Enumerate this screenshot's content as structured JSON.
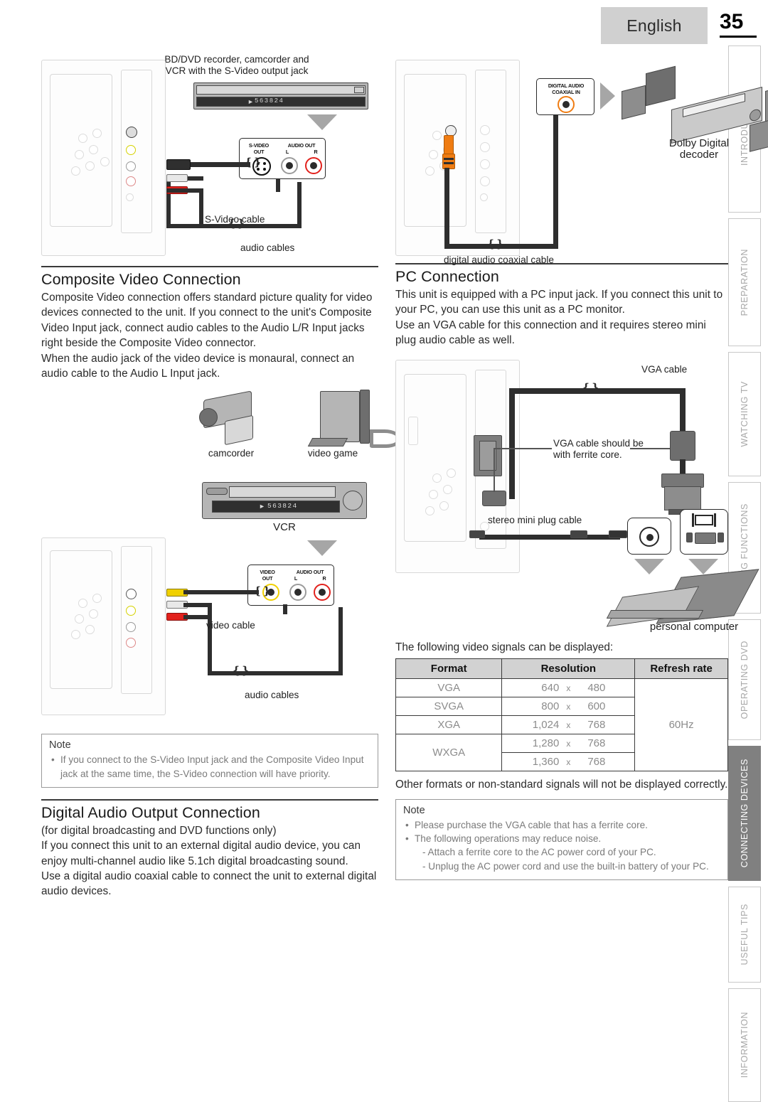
{
  "header": {
    "language": "English",
    "page_number": "35"
  },
  "side_tabs": [
    {
      "label": "INTRODUCTION",
      "active": false
    },
    {
      "label": "PREPARATION",
      "active": false
    },
    {
      "label": "WATCHING TV",
      "active": false
    },
    {
      "label": "USING FUNCTIONS",
      "active": false
    },
    {
      "label": "OPERATING DVD",
      "active": false
    },
    {
      "label": "CONNECTING DEVICES",
      "active": true
    },
    {
      "label": "USEFUL TIPS",
      "active": false
    },
    {
      "label": "INFORMATION",
      "active": false
    }
  ],
  "svideo_diagram": {
    "caption_line1": "BD/DVD recorder, camcorder and",
    "caption_line2": "VCR with the S-Video output jack",
    "vcr_display": "563824",
    "jack_panel": {
      "svideo_label_line1": "S-VIDEO",
      "svideo_label_line2": "OUT",
      "audio_label": "AUDIO OUT",
      "audio_left": "L",
      "audio_right": "R"
    },
    "cable_svideo": "S-Video cable",
    "cable_audio": "audio cables"
  },
  "composite": {
    "title": "Composite Video Connection",
    "paragraph1": "Composite Video connection offers standard picture quality for video devices connected to the unit. If you connect to the unit's Composite Video Input jack, connect audio cables to the Audio L/R Input jacks right beside the Composite Video connector.",
    "paragraph2": "When the audio jack of the video device is monaural, connect an audio cable to the Audio L Input jack.",
    "devices": {
      "camcorder": "camcorder",
      "video_game": "video game",
      "vcr": "VCR",
      "vcr_display": "563824"
    },
    "jack_panel": {
      "video_label_line1": "VIDEO",
      "video_label_line2": "OUT",
      "audio_label": "AUDIO OUT",
      "audio_left": "L",
      "audio_right": "R"
    },
    "cable_video": "video cable",
    "cable_audio": "audio cables",
    "note": {
      "title": "Note",
      "items": [
        "If you connect to the S-Video Input jack and the Composite Video Input jack at the same time, the S-Video connection will have priority."
      ]
    }
  },
  "digital_audio": {
    "title": "Digital Audio Output Connection",
    "subtitle": "(for digital broadcasting and DVD functions only)",
    "paragraph1": "If you connect this unit to an external digital audio device, you can enjoy multi-channel audio like 5.1ch digital broadcasting sound.",
    "paragraph2": "Use a digital audio coaxial cable to connect the unit to external digital audio devices.",
    "jack_label_line1": "DIGITAL AUDIO",
    "jack_label_line2": "COAXIAL  IN",
    "decoder_line1": "Dolby Digital",
    "decoder_line2": "decoder",
    "cable_label": "digital audio coaxial cable"
  },
  "pc": {
    "title": "PC Connection",
    "paragraph1": "This unit is equipped with a PC input jack. If you connect this unit to your PC, you can use this unit as a PC monitor.",
    "paragraph2": "Use an VGA cable for this connection and it requires stereo mini plug audio cable as well.",
    "label_vga_cable": "VGA cable",
    "label_ferrite_line1": "VGA cable should be",
    "label_ferrite_line2": "with ferrite core.",
    "label_stereo_mini": "stereo mini plug cable",
    "label_pc": "personal computer",
    "signals_intro": "The following video signals can be displayed:",
    "other_formats": "Other formats or non-standard signals will not be displayed correctly.",
    "note": {
      "title": "Note",
      "items": [
        "Please purchase the VGA cable that has a ferrite core.",
        "The following operations may reduce noise."
      ],
      "subitems": [
        "- Attach a ferrite core to the AC power cord of your PC.",
        "- Unplug the AC power cord and use the built-in battery of your PC."
      ]
    },
    "signal_table": {
      "headers": [
        "Format",
        "Resolution",
        "Refresh rate"
      ],
      "rows": [
        {
          "format": "VGA",
          "width": "640",
          "x": "x",
          "height": "480"
        },
        {
          "format": "SVGA",
          "width": "800",
          "x": "x",
          "height": "600"
        },
        {
          "format": "XGA",
          "width": "1,024",
          "x": "x",
          "height": "768"
        },
        {
          "format": "WXGA",
          "width": "1,280",
          "x": "x",
          "height": "768"
        },
        {
          "format": "",
          "width": "1,360",
          "x": "x",
          "height": "768"
        }
      ],
      "refresh_rate": "60Hz"
    }
  },
  "colors": {
    "accent_orange": "#ef7c12",
    "rca_yellow": "#f0d000",
    "rca_red": "#e2211c",
    "rca_white": "#ffffff",
    "tab_active": "#808080",
    "header_band": "#d0d0d0"
  }
}
